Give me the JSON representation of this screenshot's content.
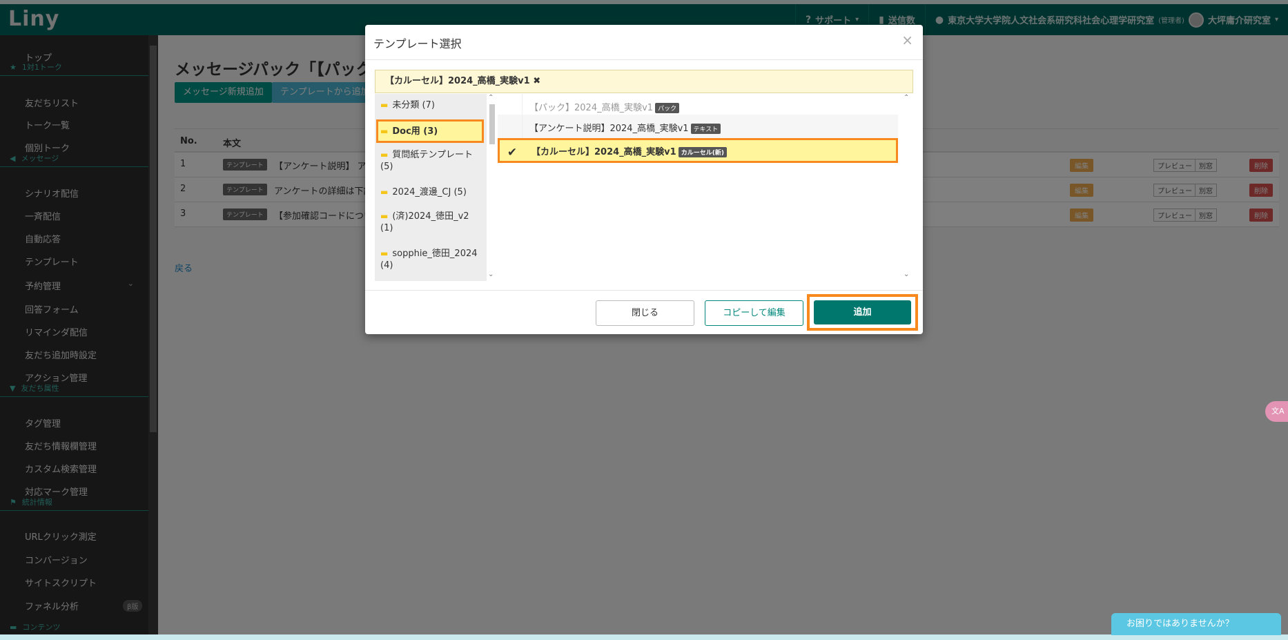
{
  "header": {
    "logo": "Liny",
    "support": "サポート",
    "sent_count": "送信数",
    "account": "東京大学大学院人文社会系研究科社会心理学研究室",
    "account_role": "(管理者)",
    "workspace": "大坪庸介研究室"
  },
  "sidebar": {
    "top": "トップ",
    "talk_head": "1対1トーク",
    "friends_list": "友だちリスト",
    "talk_list": "トーク一覧",
    "personal_talk": "個別トーク",
    "message_head": "メッセージ",
    "scenario": "シナリオ配信",
    "broadcast": "一斉配信",
    "auto_reply": "自動応答",
    "template": "テンプレート",
    "reservation": "予約管理",
    "answer_form": "回答フォーム",
    "reminder": "リマインダ配信",
    "friend_add_setting": "友だち追加時設定",
    "action_manage": "アクション管理",
    "attr_head": "友だち属性",
    "tag_manage": "タグ管理",
    "friend_info_manage": "友だち情報欄管理",
    "custom_search": "カスタム検索管理",
    "mark_manage": "対応マーク管理",
    "stats_head": "統計情報",
    "url_click": "URLクリック測定",
    "conversion": "コンバージョン",
    "site_script": "サイトスクリプト",
    "funnel": "ファネル分析",
    "beta": "β版",
    "content_head": "コンテンツ"
  },
  "main": {
    "title": "メッセージパック「【パック",
    "new_message_btn": "メッセージ新規追加",
    "from_template_btn": "テンプレートから追加",
    "col_no": "No.",
    "col_body": "本文",
    "rows": [
      {
        "no": "1",
        "tag": "テンプレート",
        "text": "【アンケート説明】 アン"
      },
      {
        "no": "2",
        "tag": "テンプレート",
        "text": "アンケートの詳細は下記"
      },
      {
        "no": "3",
        "tag": "テンプレート",
        "text": "【参加確認コードについ"
      }
    ],
    "edit_label": "編集",
    "preview_label": "プレビュー",
    "alt_window_label": "別窓",
    "delete_label": "削除",
    "back": "戻る"
  },
  "modal": {
    "title": "テンプレート選択",
    "selected": "【カルーセル】2024_高橋_実験v1 ✖",
    "folders": [
      {
        "label": "未分類 (7)"
      },
      {
        "label": "Doc用 (3)"
      },
      {
        "label": "質問紙テンプレート (5)"
      },
      {
        "label": "2024_渡邊_CJ (5)"
      },
      {
        "label": "(済)2024_徳田_v2 (1)"
      },
      {
        "label": "sopphie_徳田_2024 (4)"
      }
    ],
    "templates": [
      {
        "label": "【パック】2024_高橋_実験v1",
        "badge": "パック"
      },
      {
        "label": "【アンケート説明】2024_高橋_実験v1",
        "badge": "テキスト"
      },
      {
        "label": "【カルーセル】2024_高橋_実験v1",
        "badge": "カルーセル(新)"
      }
    ],
    "close_btn": "閉じる",
    "copy_edit_btn": "コピーして編集",
    "add_btn": "追加"
  },
  "help": "お困りではありませんか？",
  "translate_fab": "文A"
}
